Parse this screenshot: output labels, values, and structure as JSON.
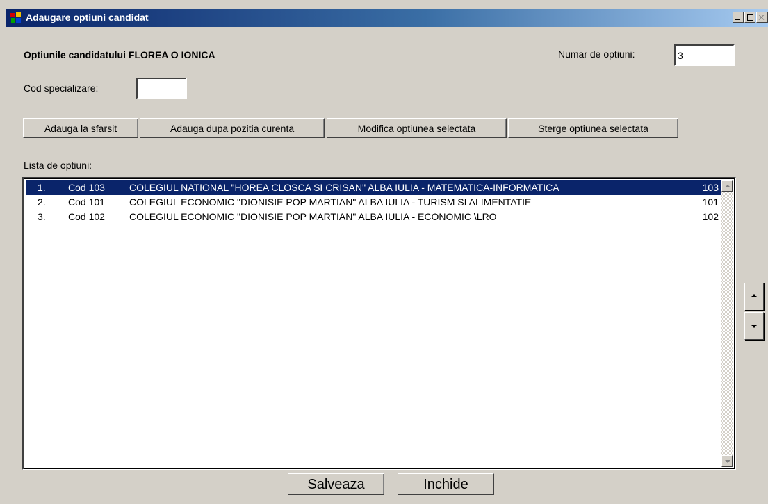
{
  "window": {
    "title": "Adaugare optiuni candidat"
  },
  "header": {
    "candidate_label": "Optiunile candidatului FLOREA O IONICA",
    "count_label": "Numar de optiuni:",
    "count_value": "3"
  },
  "form": {
    "cod_label": "Cod specializare:",
    "cod_value": ""
  },
  "toolbar": {
    "add_end": "Adauga la sfarsit",
    "add_after": "Adauga dupa pozitia curenta",
    "modify": "Modifica optiunea selectata",
    "delete": "Sterge optiunea selectata"
  },
  "list": {
    "label": "Lista de optiuni:",
    "selected_index": 0,
    "items": [
      {
        "num": "1.",
        "cod": "Cod 103",
        "name": "COLEGIUL NATIONAL \"HOREA CLOSCA SI CRISAN\" ALBA IULIA - MATEMATICA-INFORMATICA",
        "code": "103"
      },
      {
        "num": "2.",
        "cod": "Cod 101",
        "name": "COLEGIUL ECONOMIC \"DIONISIE POP MARTIAN\" ALBA IULIA - TURISM SI ALIMENTATIE",
        "code": "101"
      },
      {
        "num": "3.",
        "cod": "Cod 102",
        "name": "COLEGIUL ECONOMIC \"DIONISIE POP MARTIAN\" ALBA IULIA - ECONOMIC \\LRO",
        "code": "102"
      }
    ]
  },
  "footer": {
    "save": "Salveaza",
    "close": "Inchide"
  }
}
